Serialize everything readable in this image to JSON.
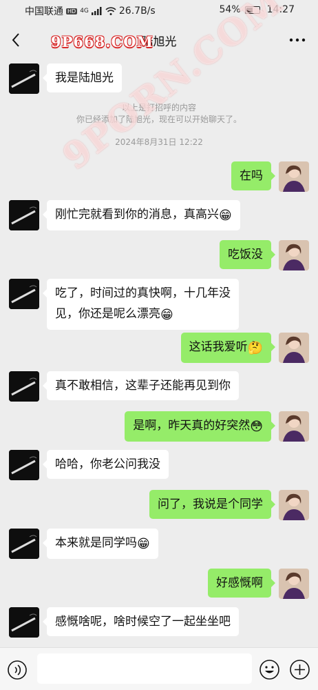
{
  "status_bar": {
    "carrier": "中国联通",
    "hd": "HD",
    "network": "4G",
    "speed": "26.7B/s",
    "battery": "54%",
    "battery_level": 0.54,
    "time": "14:27"
  },
  "header": {
    "title": "陆旭光",
    "watermark": "9P668.COM"
  },
  "watermark_diag": "9PORN.COM",
  "system": {
    "greeting_line1": "以上是打招呼的内容",
    "greeting_line2": "你已经添加了陆旭光，现在可以开始聊天了。",
    "timestamp": "2024年8月31日 12:22"
  },
  "messages": [
    {
      "side": "left",
      "text": "我是陆旭光"
    },
    {
      "side": "right",
      "text": "在吗"
    },
    {
      "side": "left",
      "text": "刚忙完就看到你的消息，真高兴",
      "emoji": "😁"
    },
    {
      "side": "right",
      "text": "吃饭没"
    },
    {
      "side": "left",
      "line1": "吃了，时间过的真快啊，十几年没",
      "line2": "见，你还是呢么漂亮",
      "emoji": "😁"
    },
    {
      "side": "right",
      "text": "这话我爱听",
      "emoji": "🤔"
    },
    {
      "side": "left",
      "text": "真不敢相信，这辈子还能再见到你"
    },
    {
      "side": "right",
      "text": "是啊，昨天真的好突然",
      "emoji": "😳"
    },
    {
      "side": "left",
      "text": "哈哈，你老公问我没"
    },
    {
      "side": "right",
      "text": "问了，我说是个同学"
    },
    {
      "side": "left",
      "text": "本来就是同学吗",
      "emoji": "😁"
    },
    {
      "side": "right",
      "text": "好感慨啊"
    },
    {
      "side": "left",
      "text": "感慨啥呢，啥时候空了一起坐坐吧"
    }
  ],
  "input_bar": {
    "placeholder": ""
  },
  "colors": {
    "background": "#ededed",
    "sent_bubble": "#95ec69",
    "received_bubble": "#ffffff",
    "watermark": "#d82929"
  }
}
